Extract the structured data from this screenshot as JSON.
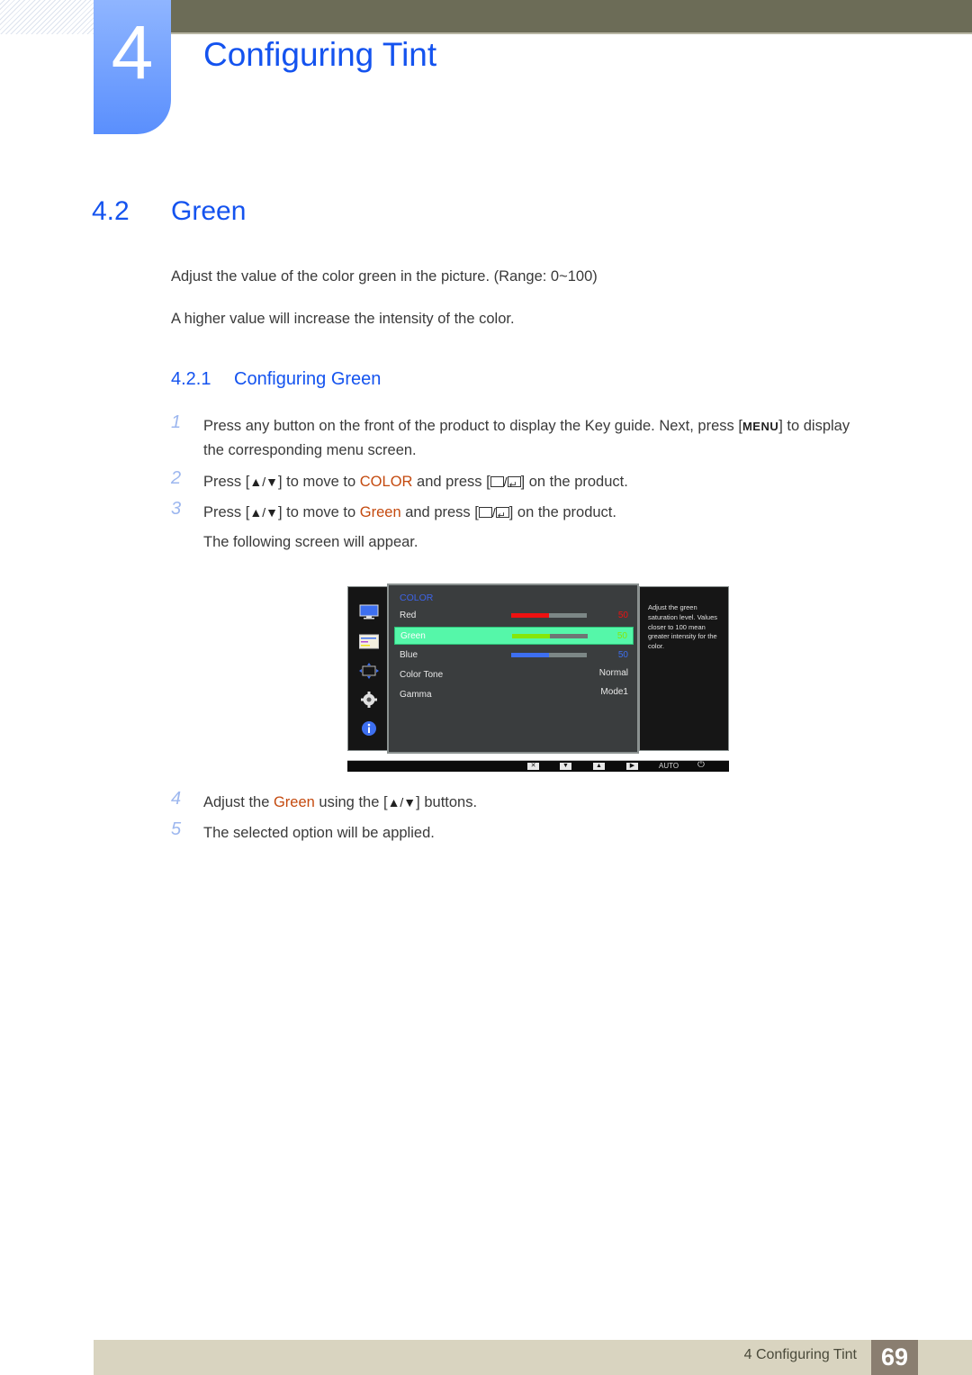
{
  "chapter": {
    "number": "4",
    "title": "Configuring Tint"
  },
  "section": {
    "number": "4.2",
    "title": "Green"
  },
  "intro": [
    "Adjust the value of the color green in the picture. (Range: 0~100)",
    "A higher value will increase the intensity of the color."
  ],
  "subsection": {
    "number": "4.2.1",
    "title": "Configuring Green"
  },
  "steps": [
    {
      "n": "1",
      "pre": "Press any button on the front of the product to display the Key guide. Next, press [",
      "key": "MENU",
      "post": "] to display",
      "line2": "the corresponding menu screen."
    },
    {
      "n": "2",
      "pre": "Press [",
      "arrows": "▲/▼",
      "mid": "] to move to ",
      "hl": "COLOR",
      "mid2": " and press [",
      "post": "] on the product."
    },
    {
      "n": "3",
      "pre": "Press [",
      "arrows": "▲/▼",
      "mid": "] to move to ",
      "hl": "Green",
      "mid2": " and press [",
      "post": "] on the product.",
      "line2": "The following screen will appear."
    },
    {
      "n": "4",
      "pre": "Adjust the ",
      "hl": "Green",
      "mid": " using the [",
      "arrows": "▲/▼",
      "post": "] buttons."
    },
    {
      "n": "5",
      "pre": "The selected option will be applied."
    }
  ],
  "osd": {
    "sidebar_icons": [
      "monitor-icon",
      "color-settings-icon",
      "size-position-icon",
      "gear-icon",
      "info-icon"
    ],
    "heading": "COLOR",
    "rows": [
      {
        "label": "Red",
        "value": "50",
        "level": 0.5,
        "color": "#ee1111",
        "selected": false
      },
      {
        "label": "Green",
        "value": "50",
        "level": 0.5,
        "color": "#86e60a",
        "selected": true
      },
      {
        "label": "Blue",
        "value": "50",
        "level": 0.5,
        "color": "#3d6ff0",
        "selected": false
      },
      {
        "label": "Color Tone",
        "value": "Normal"
      },
      {
        "label": "Gamma",
        "value": "Mode1"
      }
    ],
    "help": "Adjust the green saturation level. Values closer to 100 mean greater intensity for the color.",
    "keybar": {
      "auto": "AUTO"
    }
  },
  "footer": {
    "label": "4 Configuring Tint",
    "page": "69"
  }
}
